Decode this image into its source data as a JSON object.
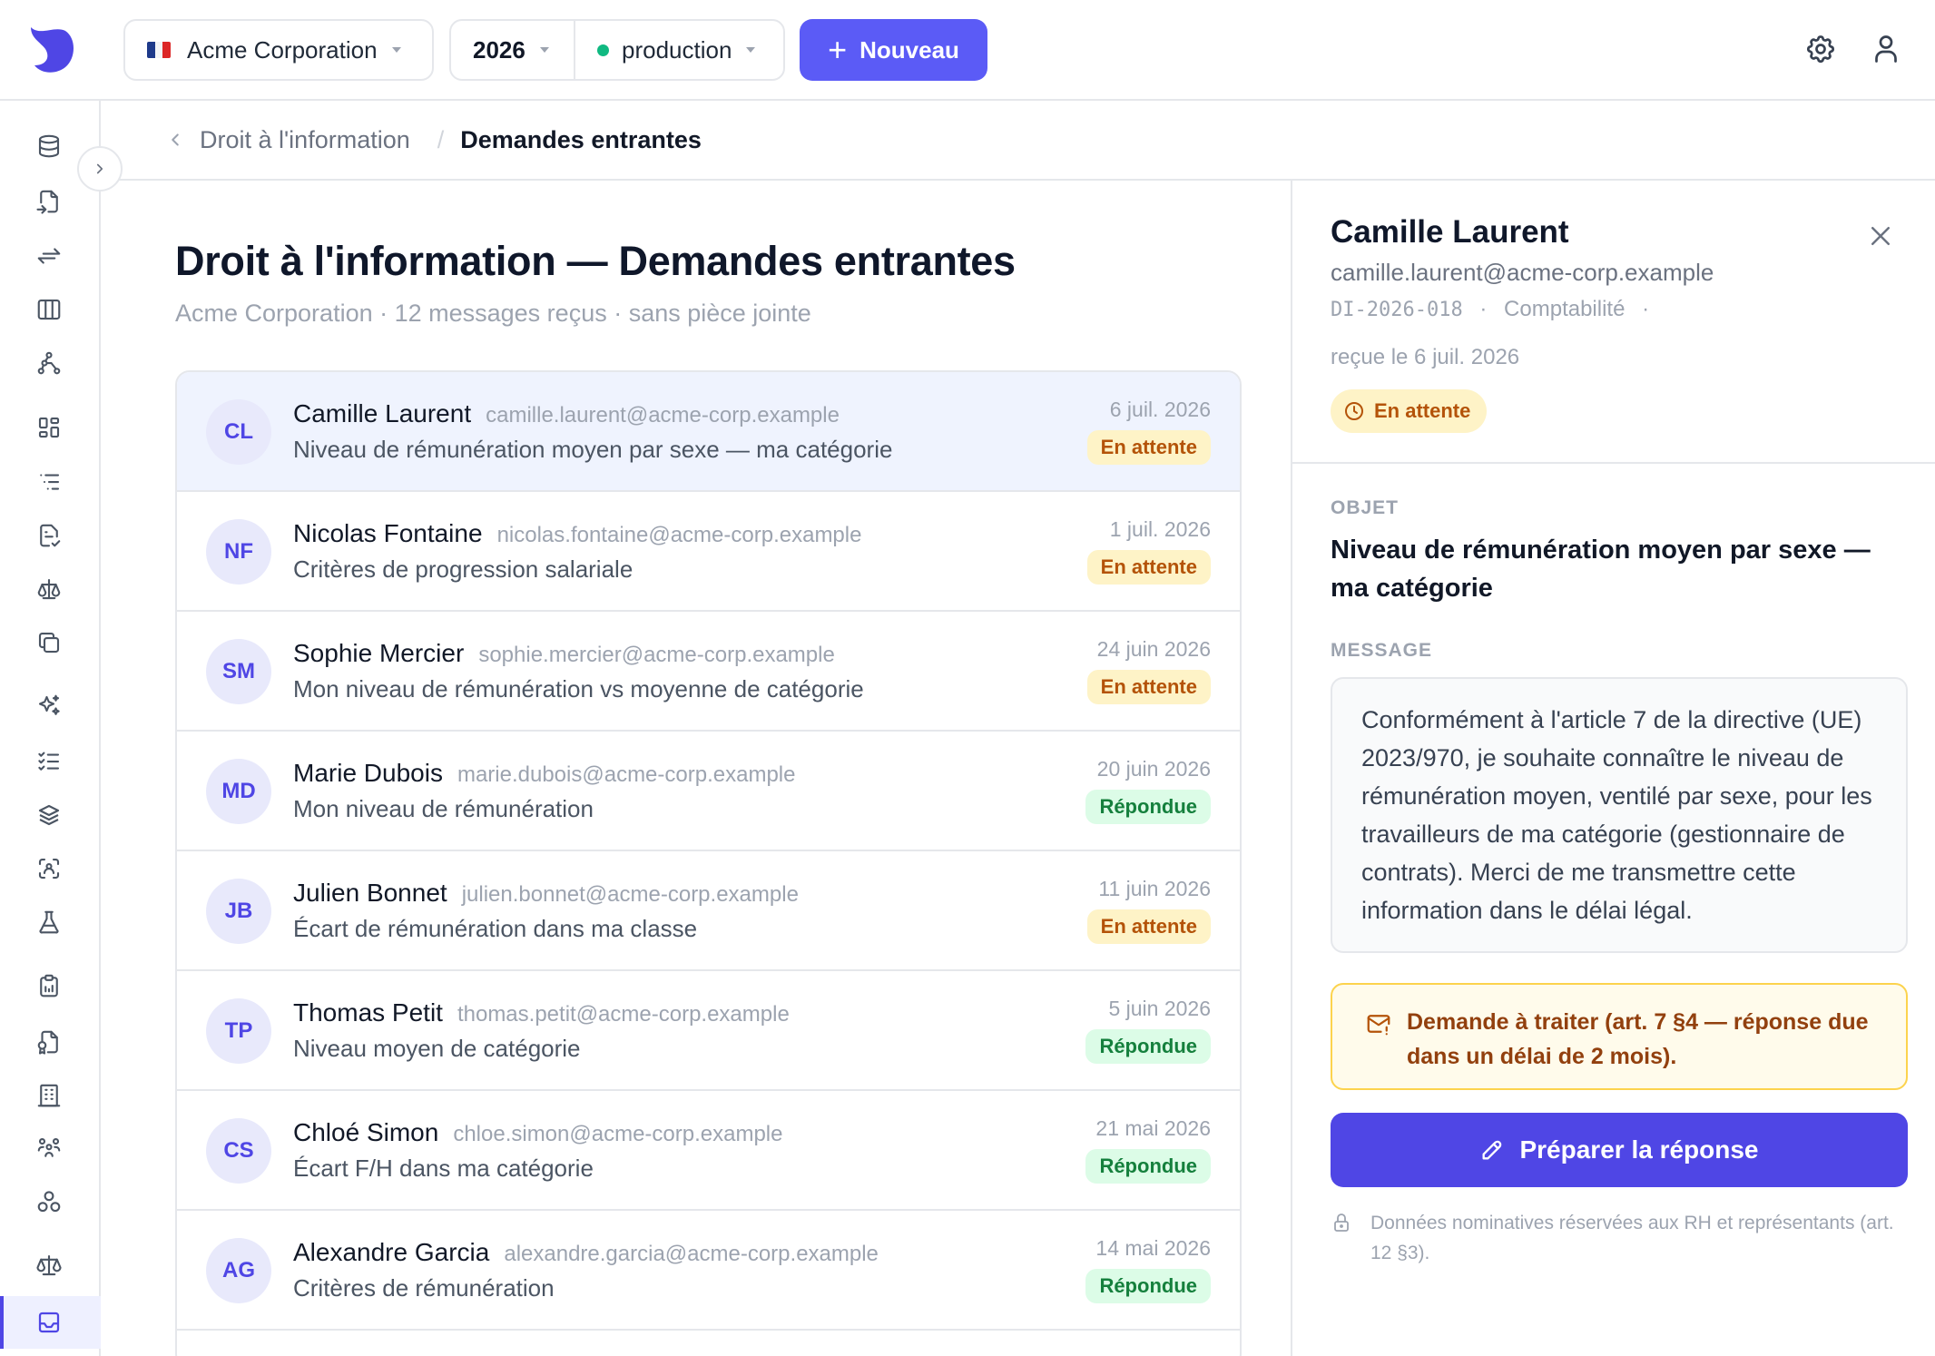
{
  "topbar": {
    "organization": "Acme Corporation",
    "year": "2026",
    "environment": "production",
    "new_label": "Nouveau",
    "colors": {
      "accent": "#5b5bf6",
      "env_dot": "#10b981"
    },
    "icons": [
      "logo-icon",
      "settings-icon",
      "user-icon"
    ]
  },
  "sidebar": {
    "active_index": 21,
    "icons": [
      "database-icon",
      "file-import-icon",
      "arrows-exchange-icon",
      "columns-icon",
      "network-icon",
      "dashboard-icon",
      "list-tree-icon",
      "file-check-icon",
      "scale-icon",
      "copy-icon",
      "sparkles-icon",
      "checklist-icon",
      "layers-icon",
      "face-scan-icon",
      "flask-icon",
      "clipboard-icon",
      "file-contract-icon",
      "building-icon",
      "users-group-icon",
      "circles-icon",
      "balance-icon",
      "inbox-icon"
    ]
  },
  "breadcrumb": {
    "parent": "Droit à l'information",
    "separator": "/",
    "current": "Demandes entrantes"
  },
  "page": {
    "title": "Droit à l'information — Demandes entrantes",
    "subtitle": "Acme Corporation · 12 messages reçus · sans pièce jointe"
  },
  "requests": [
    {
      "initials": "CL",
      "name": "Camille Laurent",
      "email": "camille.laurent@acme-corp.example",
      "subject": "Niveau de rémunération moyen par sexe — ma catégorie",
      "date": "6 juil. 2026",
      "status": "En attente",
      "state": "pending",
      "selected": true
    },
    {
      "initials": "NF",
      "name": "Nicolas Fontaine",
      "email": "nicolas.fontaine@acme-corp.example",
      "subject": "Critères de progression salariale",
      "date": "1 juil. 2026",
      "status": "En attente",
      "state": "pending"
    },
    {
      "initials": "SM",
      "name": "Sophie Mercier",
      "email": "sophie.mercier@acme-corp.example",
      "subject": "Mon niveau de rémunération vs moyenne de catégorie",
      "date": "24 juin 2026",
      "status": "En attente",
      "state": "pending"
    },
    {
      "initials": "MD",
      "name": "Marie Dubois",
      "email": "marie.dubois@acme-corp.example",
      "subject": "Mon niveau de rémunération",
      "date": "20 juin 2026",
      "status": "Répondue",
      "state": "answered"
    },
    {
      "initials": "JB",
      "name": "Julien Bonnet",
      "email": "julien.bonnet@acme-corp.example",
      "subject": "Écart de rémunération dans ma classe",
      "date": "11 juin 2026",
      "status": "En attente",
      "state": "pending"
    },
    {
      "initials": "TP",
      "name": "Thomas Petit",
      "email": "thomas.petit@acme-corp.example",
      "subject": "Niveau moyen de catégorie",
      "date": "5 juin 2026",
      "status": "Répondue",
      "state": "answered"
    },
    {
      "initials": "CS",
      "name": "Chloé Simon",
      "email": "chloe.simon@acme-corp.example",
      "subject": "Écart F/H dans ma catégorie",
      "date": "21 mai 2026",
      "status": "Répondue",
      "state": "answered"
    },
    {
      "initials": "AG",
      "name": "Alexandre Garcia",
      "email": "alexandre.garcia@acme-corp.example",
      "subject": "Critères de rémunération",
      "date": "14 mai 2026",
      "status": "Répondue",
      "state": "answered"
    }
  ],
  "detail": {
    "name": "Camille Laurent",
    "email": "camille.laurent@acme-corp.example",
    "reference": "DI-2026-018",
    "department": "Comptabilité",
    "meta_separator": "·",
    "received": "reçue le 6 juil. 2026",
    "status": "En attente",
    "object_label": "OBJET",
    "object": "Niveau de rémunération moyen par sexe — ma catégorie",
    "message_label": "MESSAGE",
    "message": "Conformément à l'article 7 de la directive (UE) 2023/970, je souhaite connaître le niveau de rémunération moyen, ventilé par sexe, pour les travailleurs de ma catégorie (gestionnaire de contrats). Merci de me transmettre cette information dans le délai légal.",
    "alert": "Demande à traiter (art. 7 §4 — réponse due dans un délai de 2 mois).",
    "cta": "Préparer la réponse",
    "note": "Données nominatives réservées aux RH et représentants (art. 12 §3)."
  }
}
